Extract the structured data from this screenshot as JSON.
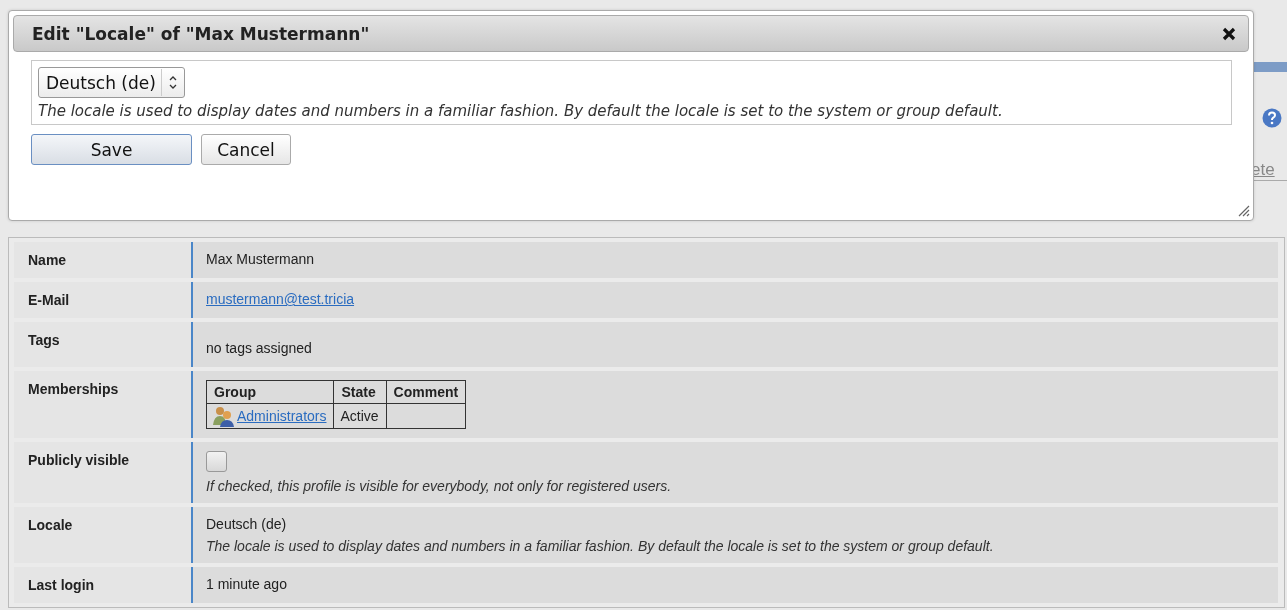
{
  "background": {
    "link": "ete"
  },
  "dialog": {
    "title": "Edit \"Locale\" of \"Max Mustermann\"",
    "select": {
      "value": "Deutsch (de)"
    },
    "hint": "The locale is used to display dates and numbers in a familiar fashion. By default the locale is set to the system or group default.",
    "buttons": [
      {
        "label": "Save",
        "default": true
      },
      {
        "label": "Cancel",
        "default": false
      }
    ]
  },
  "profile": {
    "rows": [
      {
        "label": "Name",
        "kind": "text",
        "value": "Max Mustermann"
      },
      {
        "label": "E-Mail",
        "kind": "link",
        "value": "mustermann@test.tricia"
      },
      {
        "label": "Tags",
        "kind": "text",
        "value": "no tags assigned"
      },
      {
        "label": "Memberships",
        "kind": "table",
        "columns": [
          "Group",
          "State",
          "Comment"
        ],
        "rows": [
          {
            "group": "Administrators",
            "state": "Active"
          }
        ]
      },
      {
        "label": "Publicly visible",
        "kind": "checkbox",
        "checked": false,
        "hint": "If checked, this profile is visible for everybody, not only for registered users."
      },
      {
        "label": "Locale",
        "kind": "text",
        "value": "Deutsch (de)",
        "hint": "The locale is used to display dates and numbers in a familiar fashion. By default the locale is set to the system or group default."
      },
      {
        "label": "Last login",
        "kind": "text",
        "value": "1 minute ago"
      }
    ]
  }
}
